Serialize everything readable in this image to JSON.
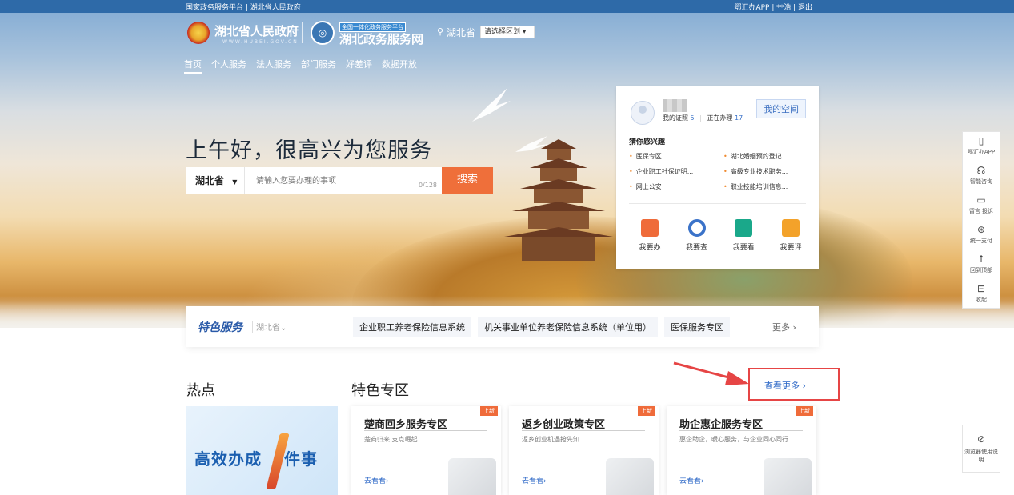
{
  "topbar": {
    "left": "国家政务服务平台 | 湖北省人民政府",
    "right": "鄂汇办APP | **浩 | 退出"
  },
  "header": {
    "gov_name": "湖北省人民政府",
    "gov_sub": "WWW.HUBEI.GOV.CN",
    "portal_tag": "全国一体化政务服务平台",
    "portal_name": "湖北政务服务网",
    "location": "湖北省",
    "region_select": "请选择区划 ▾"
  },
  "nav": [
    "首页",
    "个人服务",
    "法人服务",
    "部门服务",
    "好差评",
    "数据开放"
  ],
  "greeting": "上午好，很高兴为您服务",
  "search": {
    "province": "湖北省",
    "placeholder": "请输入您要办理的事项",
    "counter": "0/128",
    "button": "搜索"
  },
  "user_panel": {
    "stats_prefix": "我的证照",
    "stats_count1": "5",
    "stats_mid": "正在办理",
    "stats_count2": "17",
    "my_space": "我的空间",
    "interest_title": "猜你感兴趣",
    "interests": [
      "医保专区",
      "湖北婚姻预约登记",
      "企业职工社保证明...",
      "高级专业技术职务...",
      "网上公安",
      "职业技能培训信息..."
    ],
    "quick_actions": [
      {
        "label": "我要办",
        "color": "#ef6b3a"
      },
      {
        "label": "我要查",
        "color": "#3b73c9"
      },
      {
        "label": "我要看",
        "color": "#1aa88a"
      },
      {
        "label": "我要评",
        "color": "#f3a22a"
      }
    ]
  },
  "featured_services": {
    "title": "特色服务",
    "province": "湖北省⌄",
    "items": [
      "企业职工养老保险信息系统",
      "机关事业单位养老保险信息系统（单位用）",
      "医保服务专区"
    ],
    "more": "更多 ›"
  },
  "sections": {
    "hot": "热点",
    "zone": "特色专区",
    "see_more": "查看更多 ›"
  },
  "hot_banner": {
    "text_left": "高效办成",
    "text_right": "件事"
  },
  "zone_cards": [
    {
      "badge": "上新",
      "title": "楚商回乡服务专区",
      "desc": "楚商归来 支点崛起",
      "link": "去看看›"
    },
    {
      "badge": "上新",
      "title": "返乡创业政策专区",
      "desc": "返乡创业机遇抢先知",
      "link": "去看看›"
    },
    {
      "badge": "上新",
      "title": "助企惠企服务专区",
      "desc": "惠企助企，暖心服务，与企业同心同行",
      "link": "去看看›"
    }
  ],
  "right_toolbar": [
    {
      "icon": "phone-icon",
      "label": "鄂汇办APP"
    },
    {
      "icon": "headset-icon",
      "label": "智能咨询"
    },
    {
      "icon": "message-icon",
      "label": "留言 投诉"
    },
    {
      "icon": "yen-icon",
      "label": "统一支付"
    },
    {
      "icon": "back-to-top-icon",
      "label": "回到顶部"
    },
    {
      "icon": "collapse-icon",
      "label": "收起"
    }
  ],
  "browser_guide": "浏览器使用说明"
}
